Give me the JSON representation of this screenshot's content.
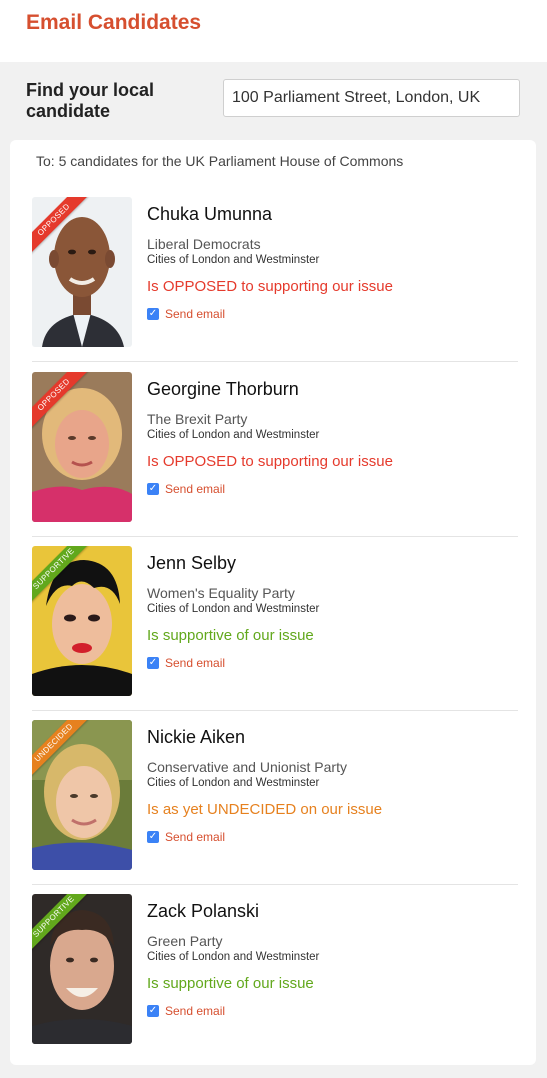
{
  "header": {
    "title": "Email Candidates"
  },
  "search": {
    "label": "Find your local candidate",
    "value": "100 Parliament Street, London, UK"
  },
  "recipients_text": "To: 5 candidates for the UK Parliament House of Commons",
  "send_email_label": "Send email",
  "stance_colors": {
    "opposed": "#e53a2c",
    "supportive": "#62a81c",
    "undecided": "#e6811f"
  },
  "candidates": [
    {
      "name": "Chuka Umunna",
      "party": "Liberal Democrats",
      "constituency": "Cities of London and Westminster",
      "stance": "opposed",
      "badge": "OPPOSED",
      "stance_text": "Is OPPOSED to supporting our issue",
      "send_email_checked": true
    },
    {
      "name": "Georgine Thorburn",
      "party": "The Brexit Party",
      "constituency": "Cities of London and Westminster",
      "stance": "opposed",
      "badge": "OPPOSED",
      "stance_text": "Is OPPOSED to supporting our issue",
      "send_email_checked": true
    },
    {
      "name": "Jenn Selby",
      "party": "Women's Equality Party",
      "constituency": "Cities of London and Westminster",
      "stance": "supportive",
      "badge": "SUPPORTIVE",
      "stance_text": "Is supportive of our issue",
      "send_email_checked": true
    },
    {
      "name": "Nickie Aiken",
      "party": "Conservative and Unionist Party",
      "constituency": "Cities of London and Westminster",
      "stance": "undecided",
      "badge": "UNDECIDED",
      "stance_text": "Is as yet UNDECIDED on our issue",
      "send_email_checked": true
    },
    {
      "name": "Zack Polanski",
      "party": "Green Party",
      "constituency": "Cities of London and Westminster",
      "stance": "supportive",
      "badge": "SUPPORTIVE",
      "stance_text": "Is supportive of our issue",
      "send_email_checked": true
    }
  ]
}
